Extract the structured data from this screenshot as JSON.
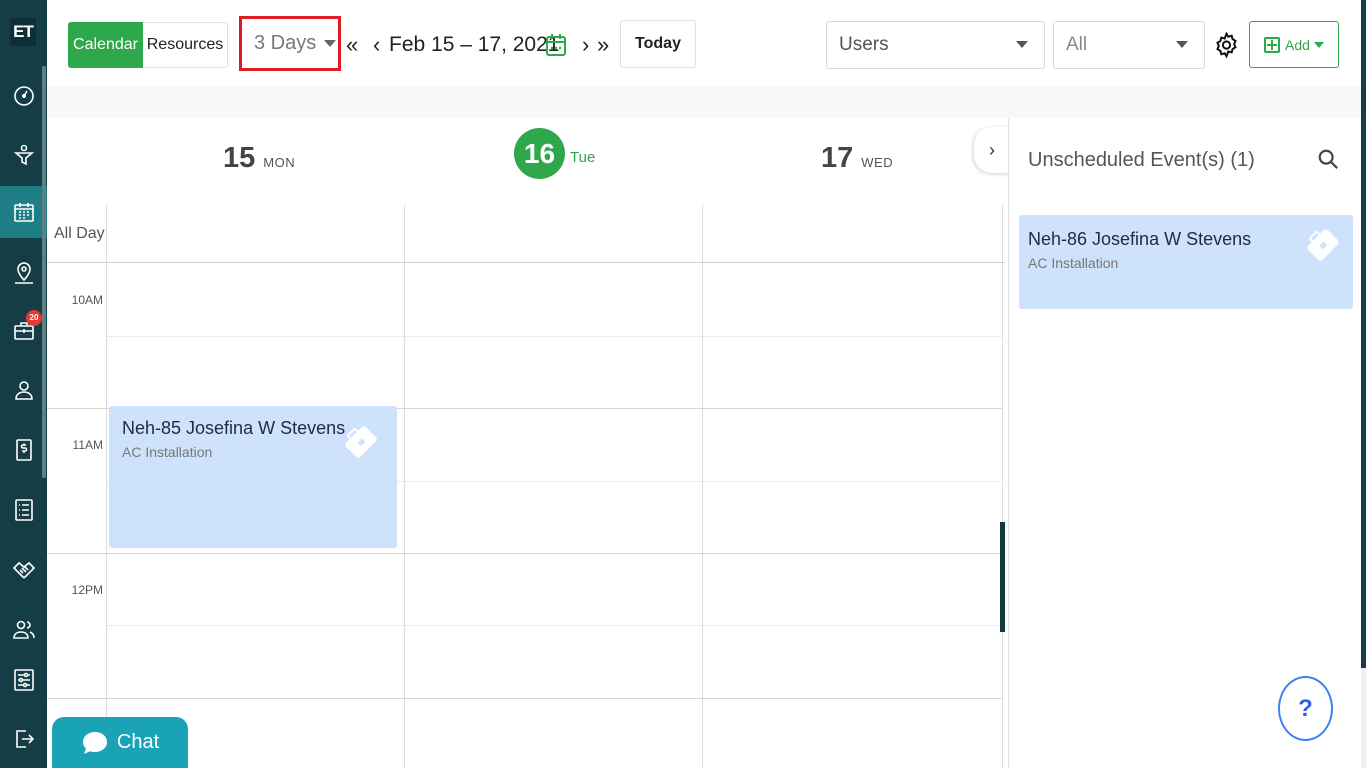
{
  "sidebar": {
    "logo": "ET",
    "items": [
      {
        "name": "dashboard",
        "icon": "gauge-icon"
      },
      {
        "name": "lead",
        "icon": "funnel-icon"
      },
      {
        "name": "calendar",
        "icon": "calendar-grid-icon",
        "active": true
      },
      {
        "name": "map",
        "icon": "map-pin-person-icon"
      },
      {
        "name": "jobs",
        "icon": "briefcase-icon",
        "badge": "20"
      },
      {
        "name": "customers",
        "icon": "person-icon"
      },
      {
        "name": "billing",
        "icon": "dollar-doc-icon"
      },
      {
        "name": "reports",
        "icon": "list-icon"
      },
      {
        "name": "deals",
        "icon": "handshake-icon"
      },
      {
        "name": "team",
        "icon": "users-icon"
      },
      {
        "name": "settings",
        "icon": "sliders-icon"
      },
      {
        "name": "logout",
        "icon": "logout-icon"
      }
    ]
  },
  "toolbar": {
    "calendar_label": "Calendar",
    "resources_label": "Resources",
    "view_select": "3 Days",
    "prev_double": "«",
    "prev": "‹",
    "date_range": "Feb 15 – 17, 2021",
    "next": "›",
    "next_double": "»",
    "today_label": "Today",
    "users_select": "Users",
    "filter_select": "All",
    "add_label": "Add"
  },
  "calendar": {
    "days": [
      {
        "num": "15",
        "dow": "MON"
      },
      {
        "num": "16",
        "dow": "Tue",
        "today": true
      },
      {
        "num": "17",
        "dow": "WED"
      }
    ],
    "all_day_label": "All Day",
    "times": [
      "10AM",
      "11AM",
      "12PM"
    ],
    "events": [
      {
        "title": "Neh-85 Josefina W Stevens",
        "subtitle": "AC Installation",
        "day": "15",
        "start": "11AM"
      }
    ]
  },
  "unscheduled": {
    "title": "Unscheduled Event(s) (1)",
    "events": [
      {
        "title": "Neh-86 Josefina W Stevens",
        "subtitle": "AC Installation"
      }
    ]
  },
  "help_label": "?",
  "chat_label": "Chat",
  "colors": {
    "sidebar": "#143d45",
    "accent_green": "#2ea84a",
    "event_bg": "#cfe2fc",
    "highlight_red": "#e01c24",
    "chat": "#1aa3b5"
  }
}
